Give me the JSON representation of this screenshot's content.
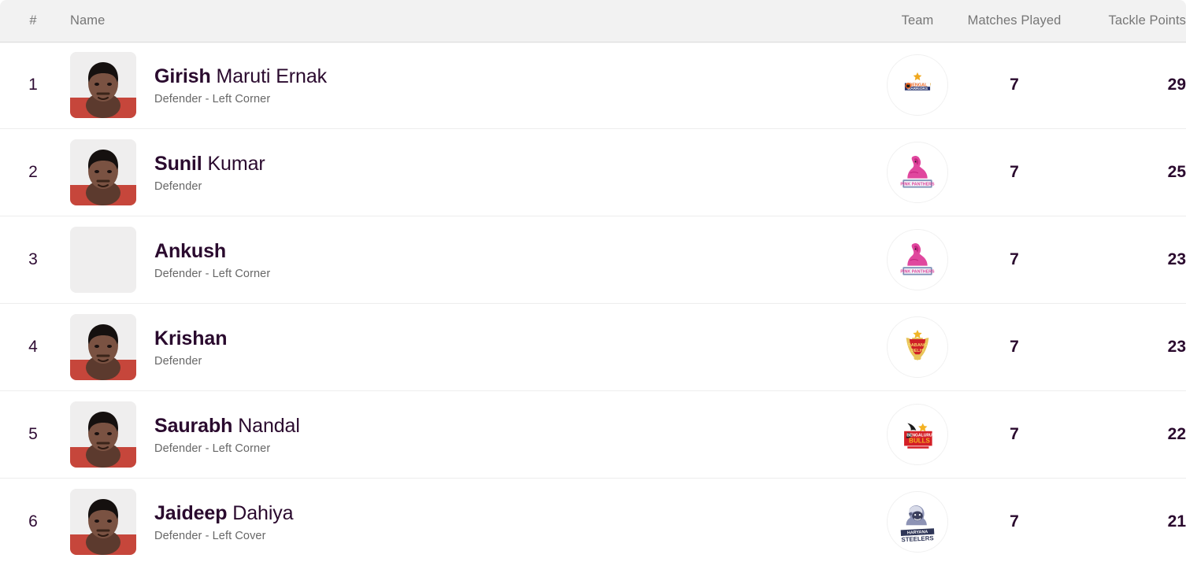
{
  "table": {
    "columns": {
      "rank": "#",
      "name": "Name",
      "team": "Team",
      "matches_played": "Matches Played",
      "tackle_points": "Tackle Points"
    },
    "colors": {
      "header_background": "#f2f2f2",
      "header_text": "#767676",
      "row_background": "#ffffff",
      "row_divider": "#ededed",
      "primary_text": "#2a0a2e",
      "secondary_text": "#676767"
    },
    "rows": [
      {
        "rank": "1",
        "first_name": "Girish",
        "last_name": "Maruti Ernak",
        "position": "Defender - Left Corner",
        "team_name": "Bengal Warriors",
        "team_logo": "bengal-warriors-logo",
        "has_photo": true,
        "matches_played": "7",
        "tackle_points": "29"
      },
      {
        "rank": "2",
        "first_name": "Sunil",
        "last_name": "Kumar",
        "position": "Defender",
        "team_name": "Jaipur Pink Panthers",
        "team_logo": "jaipur-pink-panthers-logo",
        "has_photo": true,
        "matches_played": "7",
        "tackle_points": "25"
      },
      {
        "rank": "3",
        "first_name": "Ankush",
        "last_name": "",
        "position": "Defender - Left Corner",
        "team_name": "Jaipur Pink Panthers",
        "team_logo": "jaipur-pink-panthers-logo",
        "has_photo": false,
        "matches_played": "7",
        "tackle_points": "23"
      },
      {
        "rank": "4",
        "first_name": "Krishan",
        "last_name": "",
        "position": "Defender",
        "team_name": "Dabang Delhi",
        "team_logo": "dabang-delhi-logo",
        "has_photo": true,
        "matches_played": "7",
        "tackle_points": "23"
      },
      {
        "rank": "5",
        "first_name": "Saurabh",
        "last_name": "Nandal",
        "position": "Defender - Left Corner",
        "team_name": "Bengaluru Bulls",
        "team_logo": "bengaluru-bulls-logo",
        "has_photo": true,
        "matches_played": "7",
        "tackle_points": "22"
      },
      {
        "rank": "6",
        "first_name": "Jaideep",
        "last_name": "Dahiya",
        "position": "Defender - Left Cover",
        "team_name": "Haryana Steelers",
        "team_logo": "haryana-steelers-logo",
        "has_photo": true,
        "matches_played": "7",
        "tackle_points": "21"
      }
    ]
  }
}
